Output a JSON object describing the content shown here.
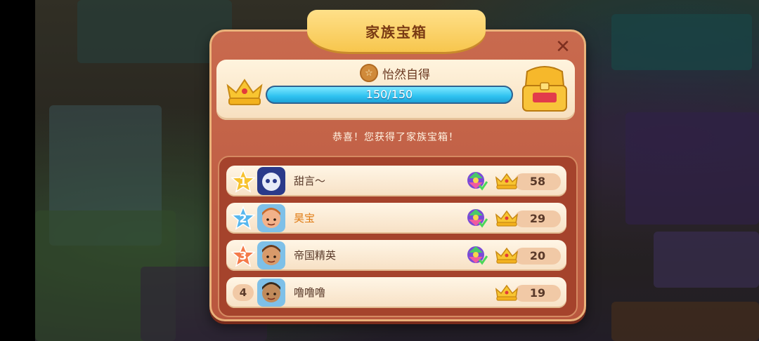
{
  "dialog": {
    "title": "家族宝箱",
    "close_icon": "close-icon"
  },
  "progress": {
    "rank_title": "怡然自得",
    "text": "150/150",
    "current": 150,
    "max": 150,
    "bar_color": "#2fc2f0"
  },
  "message": "恭喜！您获得了家族宝箱！",
  "leaderboard": [
    {
      "rank": "1",
      "name": "甜言～",
      "score": "58",
      "has_gem": true,
      "star_color": "#f7c22e",
      "highlight": false,
      "avatar": "robot-avatar"
    },
    {
      "rank": "2",
      "name": "昊宝",
      "score": "29",
      "has_gem": true,
      "star_color": "#57b7ee",
      "highlight": true,
      "avatar": "boy-avatar"
    },
    {
      "rank": "3",
      "name": "帝国精英",
      "score": "20",
      "has_gem": true,
      "star_color": "#f47a4a",
      "highlight": false,
      "avatar": "man-avatar"
    },
    {
      "rank": "4",
      "name": "噜噜噜",
      "score": "19",
      "has_gem": false,
      "star_color": "",
      "highlight": false,
      "avatar": "man2-avatar"
    }
  ],
  "colors": {
    "dialog_bg": "#c0604a",
    "title_tab": "#f7c64d",
    "accent_orange": "#e07a12"
  }
}
